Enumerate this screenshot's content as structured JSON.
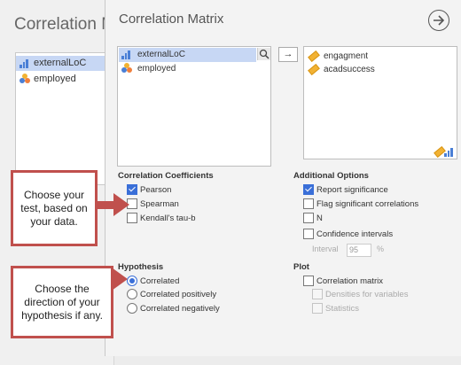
{
  "background_window": {
    "title": "Correlation Mat",
    "variables": [
      {
        "name": "externalLoC",
        "icon": "continuous-variable-icon",
        "selected": true
      },
      {
        "name": "employed",
        "icon": "nominal-variable-icon",
        "selected": false
      }
    ]
  },
  "panel": {
    "title": "Correlation Matrix",
    "source_variables": [
      {
        "name": "externalLoC",
        "icon": "continuous-variable-icon",
        "selected": true
      },
      {
        "name": "employed",
        "icon": "nominal-variable-icon",
        "selected": false
      }
    ],
    "move_arrow": "→",
    "target_variables": [
      {
        "name": "engagment",
        "icon": "ordinal-variable-icon"
      },
      {
        "name": "acadsuccess",
        "icon": "ordinal-variable-icon"
      }
    ],
    "correlation_coefficients": {
      "title": "Correlation Coefficients",
      "options": [
        {
          "label": "Pearson",
          "checked": true
        },
        {
          "label": "Spearman",
          "checked": false
        },
        {
          "label": "Kendall's tau-b",
          "checked": false
        }
      ]
    },
    "additional_options": {
      "title": "Additional Options",
      "options": [
        {
          "label": "Report significance",
          "checked": true
        },
        {
          "label": "Flag significant correlations",
          "checked": false
        },
        {
          "label": "N",
          "checked": false
        },
        {
          "label": "Confidence intervals",
          "checked": false
        }
      ],
      "interval_label": "Interval",
      "interval_value": "95",
      "interval_unit": "%"
    },
    "hypothesis": {
      "title": "Hypothesis",
      "options": [
        {
          "label": "Correlated",
          "selected": true
        },
        {
          "label": "Correlated positively",
          "selected": false
        },
        {
          "label": "Correlated negatively",
          "selected": false
        }
      ]
    },
    "plot": {
      "title": "Plot",
      "options": [
        {
          "label": "Correlation matrix",
          "checked": false,
          "enabled": true
        },
        {
          "label": "Densities for variables",
          "checked": false,
          "enabled": false
        },
        {
          "label": "Statistics",
          "checked": false,
          "enabled": false
        }
      ]
    }
  },
  "callouts": [
    {
      "text": "Choose your test, based on your data."
    },
    {
      "text": "Choose the direction of your hypothesis if any."
    }
  ],
  "colors": {
    "accent": "#3a6fd8",
    "callout_border": "#c0504d",
    "selection": "#c7d7f4"
  }
}
